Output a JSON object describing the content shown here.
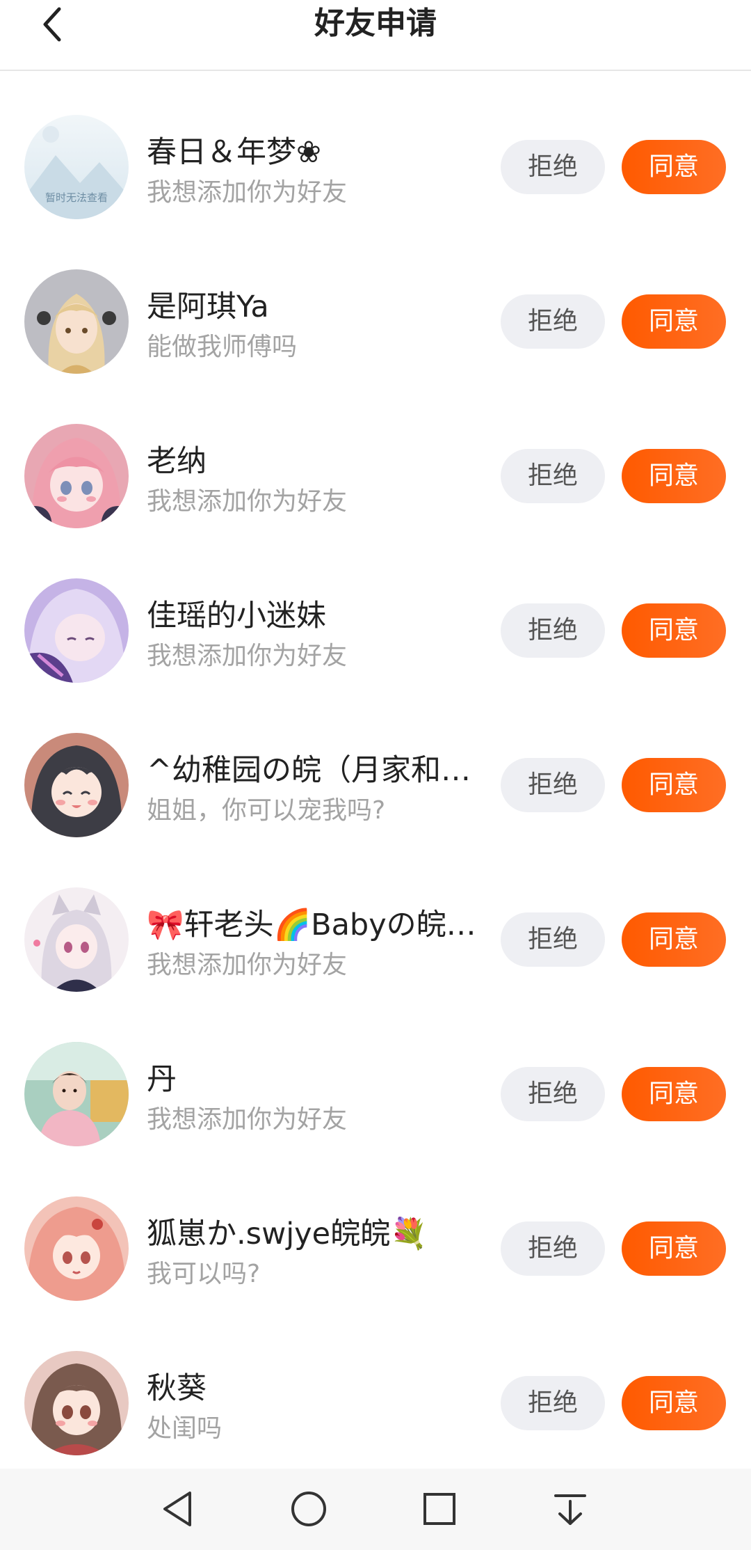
{
  "header": {
    "title": "好友申请"
  },
  "requests": [
    {
      "name": "春日＆年梦❀",
      "message": "我想添加你为好友",
      "avatar": "placeholder-avatar",
      "placeholder_text": "暂时无法查看"
    },
    {
      "name": "是阿琪Ya",
      "message": "能做我师傅吗",
      "avatar": "anime-girl-blonde-avatar"
    },
    {
      "name": "老纳",
      "message": "我想添加你为好友",
      "avatar": "anime-girl-pink-avatar"
    },
    {
      "name": "佳瑶的小迷妹",
      "message": "我想添加你为好友",
      "avatar": "anime-girl-lavender-avatar"
    },
    {
      "name": "^幼稚园の皖（月家和…",
      "message": "姐姐，你可以宠我吗?",
      "avatar": "anime-girl-dark-hair-avatar"
    },
    {
      "name": "🎀轩老头🌈Babyの皖…",
      "message": "我想添加你为好友",
      "avatar": "anime-catgirl-avatar"
    },
    {
      "name": "丹",
      "message": "我想添加你为好友",
      "avatar": "child-photo-avatar"
    },
    {
      "name": "狐崽か.swjye皖皖💐",
      "message": "我可以吗?",
      "avatar": "anime-girl-peach-avatar"
    },
    {
      "name": "秋葵",
      "message": "处闺吗",
      "avatar": "anime-girl-brown-avatar"
    }
  ],
  "buttons": {
    "reject_label": "拒绝",
    "accept_label": "同意"
  },
  "colors": {
    "accent": "#ff5f0f",
    "reject_bg": "#eeeff3",
    "text_secondary": "#a3a3a3"
  },
  "navbar": {
    "icons": [
      "back-triangle-icon",
      "home-circle-icon",
      "recents-square-icon",
      "notification-pulldown-icon"
    ]
  }
}
